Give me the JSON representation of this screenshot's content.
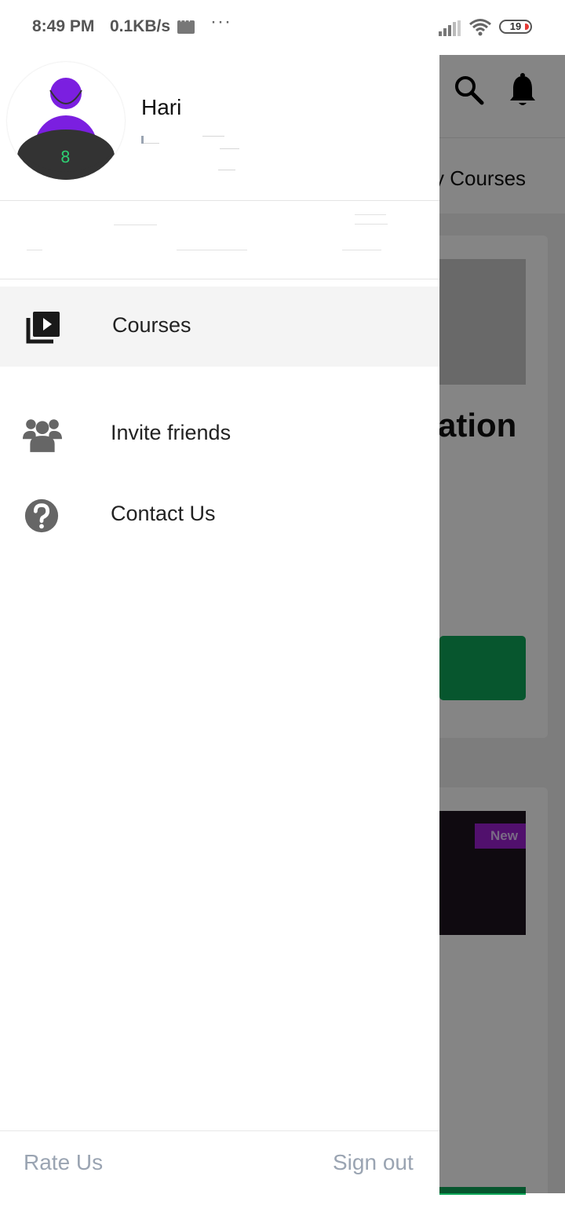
{
  "status_bar": {
    "time": "8:49 PM",
    "speed": "0.1KB/s",
    "more": "···",
    "battery": "19"
  },
  "background_app": {
    "tab_label": "y Courses",
    "card_title": "ation",
    "badge": "New"
  },
  "drawer": {
    "user_name": "Hari",
    "menu": [
      {
        "label": "Courses",
        "icon": "video-library-icon",
        "active": true
      },
      {
        "label": "Invite friends",
        "icon": "group-icon"
      },
      {
        "label": "Contact Us",
        "icon": "help-circle-icon"
      }
    ],
    "footer": {
      "rate_us": "Rate Us",
      "sign_out": "Sign out"
    }
  },
  "colors": {
    "accent_purple": "#7b1fe0",
    "green_button": "#0ea658",
    "footer_text": "#9aa4b2"
  }
}
